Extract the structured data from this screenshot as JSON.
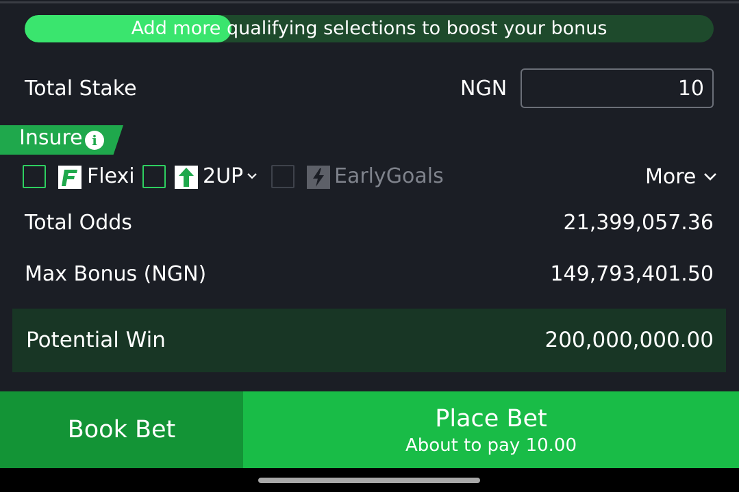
{
  "bonus_banner": {
    "text": "Add more qualifying selections to boost your bonus",
    "fill_fraction": 0.3
  },
  "stake": {
    "label": "Total Stake",
    "currency": "NGN",
    "value": "10"
  },
  "insure": {
    "label": "Insure",
    "info_icon": "info-icon"
  },
  "options": {
    "flexi": {
      "label": "Flexi",
      "icon": "flexi-icon",
      "checked": false
    },
    "twoup": {
      "label": "2UP",
      "icon": "two-up-icon",
      "checked": false
    },
    "earlygoals": {
      "label": "EarlyGoals",
      "icon": "lightning-icon",
      "checked": false,
      "enabled": false
    },
    "more": {
      "label": "More"
    }
  },
  "summary": {
    "odds_label": "Total Odds",
    "odds_value": "21,399,057.36",
    "bonus_label": "Max Bonus (NGN)",
    "bonus_value": "149,793,401.50",
    "win_label": "Potential Win",
    "win_value": "200,000,000.00"
  },
  "actions": {
    "book_label": "Book Bet",
    "place_label": "Place Bet",
    "place_sub": "About to pay 10.00"
  },
  "colors": {
    "accent_green": "#19bc47",
    "background": "#1b1e25"
  }
}
